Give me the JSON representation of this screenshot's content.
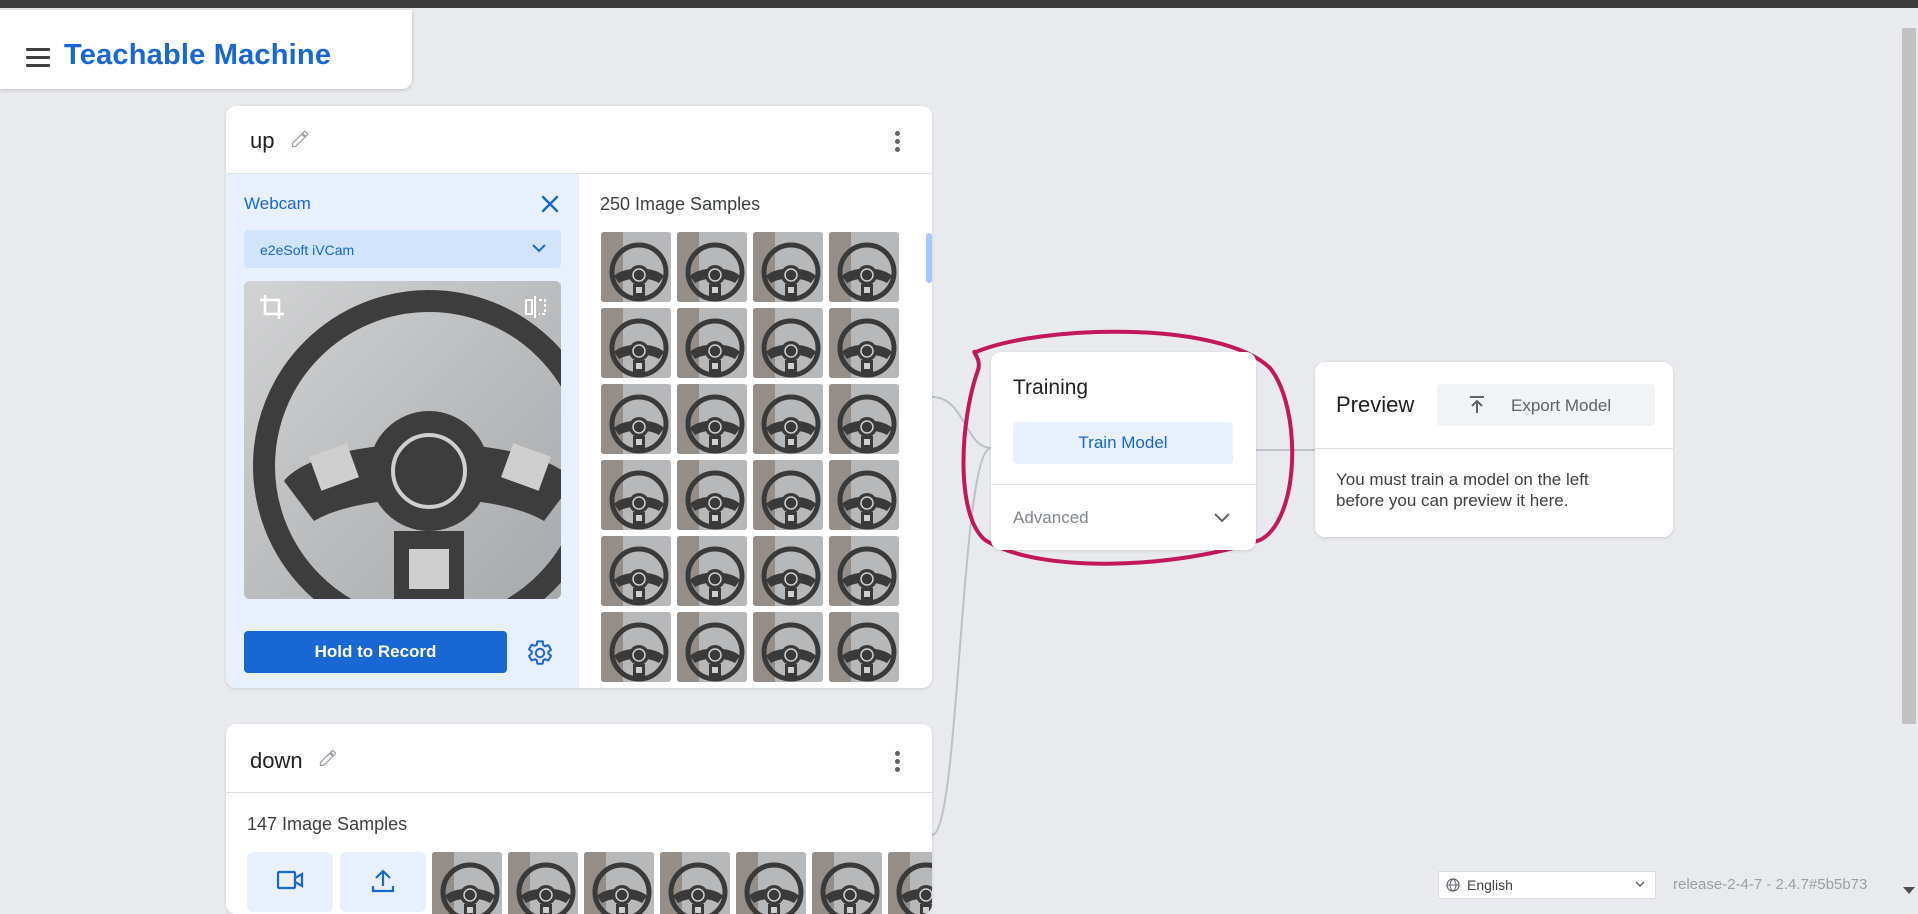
{
  "app": {
    "title": "Teachable Machine"
  },
  "class_up": {
    "name": "up",
    "webcam_label": "Webcam",
    "device": "e2eSoft iVCam",
    "record_label": "Hold to Record",
    "samples_label": "250 Image Samples"
  },
  "class_down": {
    "name": "down",
    "samples_label": "147 Image Samples",
    "tools": [
      "webcam-icon",
      "upload-icon"
    ]
  },
  "training": {
    "title": "Training",
    "train_button": "Train Model",
    "advanced_label": "Advanced"
  },
  "preview": {
    "title": "Preview",
    "export_button": "Export Model",
    "message": "You must train a model on the left before you can preview it here."
  },
  "footer": {
    "language": "English",
    "release": "release-2-4-7 - 2.4.7#5b5b73"
  },
  "colors": {
    "accent": "#1967d2",
    "annotation": "#c2185b",
    "background": "#e8eaed"
  }
}
